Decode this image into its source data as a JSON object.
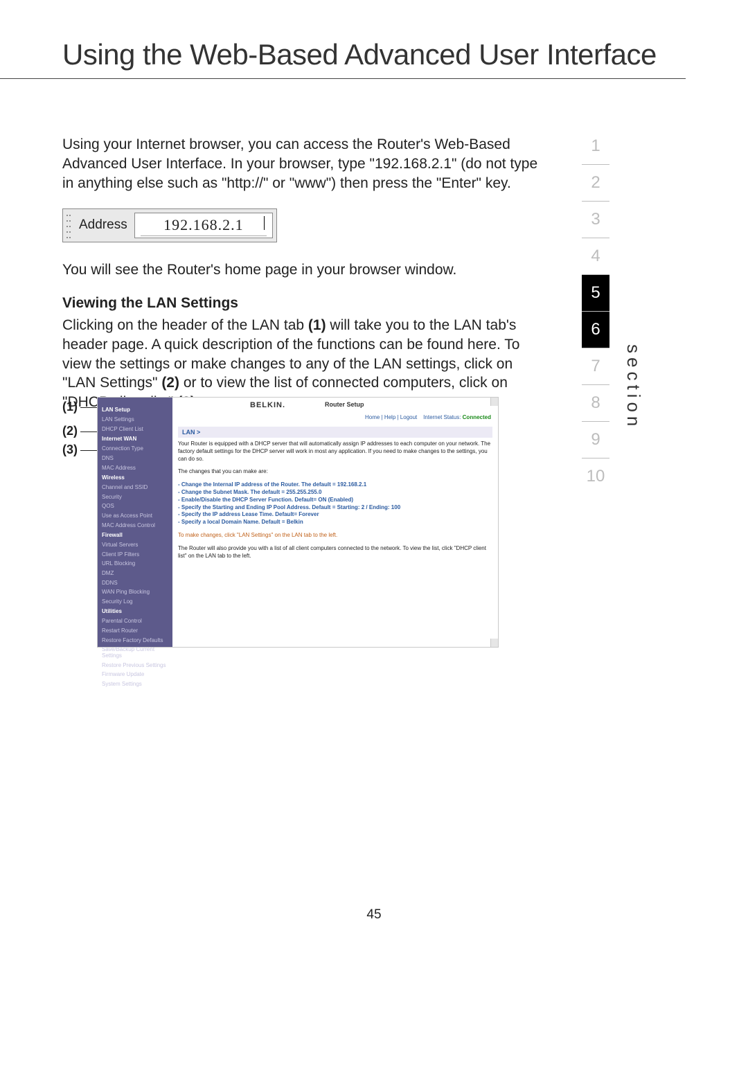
{
  "title": "Using the Web-Based Advanced User Interface",
  "intro": "Using your Internet browser, you can access the Router's Web-Based Advanced User Interface. In your browser, type \"192.168.2.1\" (do not type in anything else such as \"http://\" or \"www\") then press the \"Enter\" key.",
  "address_bar": {
    "label": "Address",
    "value": "192.168.2.1"
  },
  "after_addr": "You will see the Router's home page in your browser window.",
  "subheading": "Viewing the LAN Settings",
  "lan_para_html": "Clicking on the header of the LAN tab <b>(1)</b> will take you to the LAN tab's header page. A quick description of the functions can be found here. To view the settings or make changes to any of the LAN settings, click on \"LAN Settings\" <b>(2)</b> or to view the list of connected computers, click on \"DHCP client list\" <b>(3)</b>.",
  "section_nav": {
    "numbers": [
      "1",
      "2",
      "3",
      "4",
      "5",
      "6",
      "7",
      "8",
      "9",
      "10"
    ],
    "active": [
      "5",
      "6"
    ],
    "label": "section"
  },
  "callouts": {
    "c1": "(1)",
    "c2": "(2)",
    "c3": "(3)"
  },
  "page_number": "45",
  "router": {
    "brand": "BELKIN.",
    "page_title": "Router Setup",
    "top_links": "Home | Help | Logout    Internet Status: ",
    "status": "Connected",
    "breadcrumb": "LAN >",
    "para1": "Your Router is equipped with a DHCP server that will automatically assign IP addresses to each computer on your network. The factory default settings for the DHCP server will work in most any application. If you need to make changes to the settings, you can do so.",
    "para2": "The changes that you can make are:",
    "bullets": [
      "- Change the Internal IP address of the Router. The default = 192.168.2.1",
      "- Change the Subnet Mask. The default = 255.255.255.0",
      "- Enable/Disable the DHCP Server Function. Default= ON (Enabled)",
      "- Specify the Starting and Ending IP Pool Address. Default = Starting: 2 / Ending: 100",
      "- Specify the IP address Lease Time. Default= Forever",
      "- Specify a local Domain Name. Default = Belkin"
    ],
    "para3": "To make changes, click \"LAN Settings\" on the LAN tab to the left.",
    "para4": "The Router will also provide you with a list of all client computers connected to the network. To view the list, click \"DHCP client list\" on the LAN tab to the left.",
    "nav": [
      {
        "t": "grp",
        "l": "LAN Setup"
      },
      {
        "t": "itm",
        "l": "LAN Settings"
      },
      {
        "t": "itm",
        "l": "DHCP Client List"
      },
      {
        "t": "grp",
        "l": "Internet WAN"
      },
      {
        "t": "itm",
        "l": "Connection Type"
      },
      {
        "t": "itm",
        "l": "DNS"
      },
      {
        "t": "itm",
        "l": "MAC Address"
      },
      {
        "t": "grp",
        "l": "Wireless"
      },
      {
        "t": "itm",
        "l": "Channel and SSID"
      },
      {
        "t": "itm",
        "l": "Security"
      },
      {
        "t": "itm",
        "l": "QOS"
      },
      {
        "t": "itm",
        "l": "Use as Access Point"
      },
      {
        "t": "itm",
        "l": "MAC Address Control"
      },
      {
        "t": "grp",
        "l": "Firewall"
      },
      {
        "t": "itm",
        "l": "Virtual Servers"
      },
      {
        "t": "itm",
        "l": "Client IP Filters"
      },
      {
        "t": "itm",
        "l": "URL Blocking"
      },
      {
        "t": "itm",
        "l": "DMZ"
      },
      {
        "t": "itm",
        "l": "DDNS"
      },
      {
        "t": "itm",
        "l": "WAN Ping Blocking"
      },
      {
        "t": "itm",
        "l": "Security Log"
      },
      {
        "t": "grp",
        "l": "Utilities"
      },
      {
        "t": "itm",
        "l": "Parental Control"
      },
      {
        "t": "itm",
        "l": "Restart Router"
      },
      {
        "t": "itm",
        "l": "Restore Factory Defaults"
      },
      {
        "t": "itm",
        "l": "Save/Backup Current Settings"
      },
      {
        "t": "itm",
        "l": "Restore Previous Settings"
      },
      {
        "t": "itm",
        "l": "Firmware Update"
      },
      {
        "t": "itm",
        "l": "System Settings"
      }
    ]
  }
}
